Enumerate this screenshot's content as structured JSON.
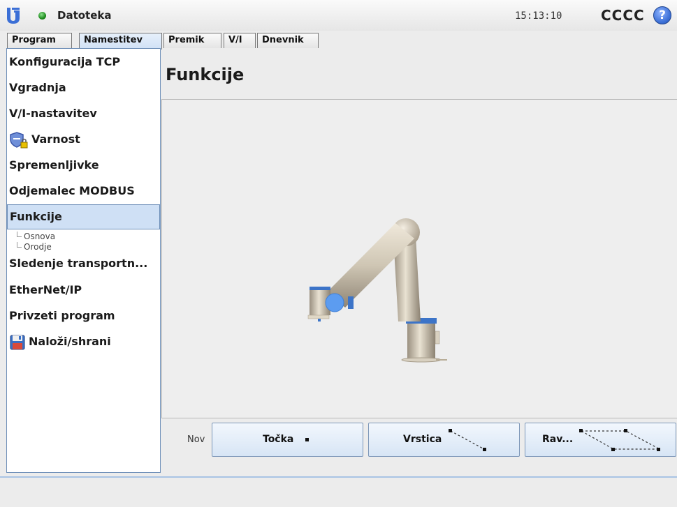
{
  "header": {
    "app_title": "Datoteka",
    "clock": "15:13:10",
    "robot_name": "CCCC",
    "help_label": "?"
  },
  "tabs": [
    {
      "label": "Program"
    },
    {
      "label": "Namestitev",
      "active": true
    },
    {
      "label": "Premik"
    },
    {
      "label": "V/I"
    },
    {
      "label": "Dnevnik"
    }
  ],
  "sidebar": {
    "items": [
      {
        "label": "Konfiguracija TCP"
      },
      {
        "label": "Vgradnja"
      },
      {
        "label": "V/I-nastavitev"
      },
      {
        "label": "Varnost",
        "icon": "shield-lock-icon"
      },
      {
        "label": "Spremenljivke"
      },
      {
        "label": "Odjemalec MODBUS"
      },
      {
        "label": "Funkcije",
        "selected": true
      },
      {
        "label": "Sledenje transportn..."
      },
      {
        "label": "EtherNet/IP"
      },
      {
        "label": "Privzeti program"
      },
      {
        "label": "Naloži/shrani",
        "icon": "floppy-disk-icon"
      }
    ],
    "subitems": [
      {
        "label": "Osnova"
      },
      {
        "label": "Orodje"
      }
    ]
  },
  "main": {
    "title": "Funkcije",
    "new_label": "Nov",
    "buttons": [
      {
        "label": "Točka",
        "icon": "point-icon"
      },
      {
        "label": "Vrstica",
        "icon": "line-icon"
      },
      {
        "label": "Rav...",
        "icon": "plane-icon"
      }
    ]
  },
  "colors": {
    "accent": "#cfe0f5",
    "border": "#6e8fb8",
    "status": "#1c8a1c",
    "help": "#3b6fd6"
  }
}
